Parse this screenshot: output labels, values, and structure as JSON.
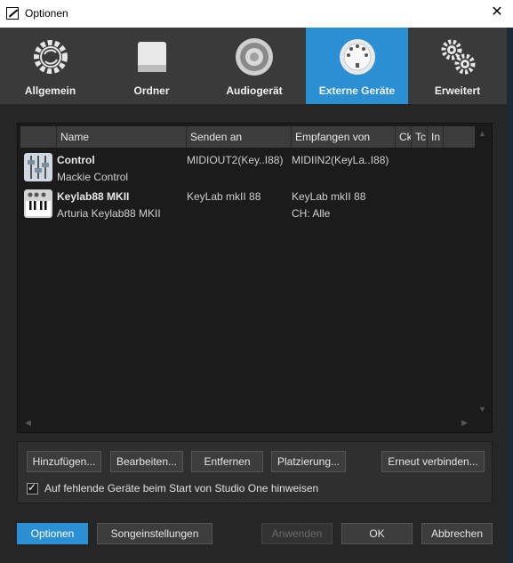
{
  "window": {
    "title": "Optionen",
    "close_glyph": "✕"
  },
  "tabs": [
    {
      "label": "Allgemein",
      "icon": "sync-gear-icon"
    },
    {
      "label": "Ordner",
      "icon": "drive-icon"
    },
    {
      "label": "Audiogerät",
      "icon": "speaker-icon"
    },
    {
      "label": "Externe Geräte",
      "icon": "midi-connector-icon",
      "active": true
    },
    {
      "label": "Erweitert",
      "icon": "gears-icon"
    }
  ],
  "table": {
    "headers": [
      "Name",
      "Senden an",
      "Empfangen von",
      "Ck",
      "Tc",
      "In"
    ],
    "rows": [
      {
        "name": "Control",
        "sub": "Mackie Control",
        "send": "MIDIOUT2(Key..I88)",
        "receive": "MIDIIN2(KeyLa..I88)",
        "receive_sub": "",
        "icon": "fader-icon"
      },
      {
        "name": "Keylab88 MKII",
        "sub": "Arturia Keylab88 MKII",
        "send": "KeyLab mkII 88",
        "receive": "KeyLab mkII 88",
        "receive_sub": "CH: Alle",
        "icon": "keyboard-icon"
      }
    ]
  },
  "buttons": {
    "add": "Hinzufügen...",
    "edit": "Bearbeiten...",
    "remove": "Entfernen",
    "placement": "Platzierung...",
    "reconnect": "Erneut verbinden..."
  },
  "checkbox_label": "Auf fehlende Geräte beim Start von Studio One hinweisen",
  "footer": {
    "options": "Optionen",
    "song_settings": "Songeinstellungen",
    "apply": "Anwenden",
    "ok": "OK",
    "cancel": "Abbrechen"
  },
  "colors": {
    "accent": "#2b8fd3"
  }
}
